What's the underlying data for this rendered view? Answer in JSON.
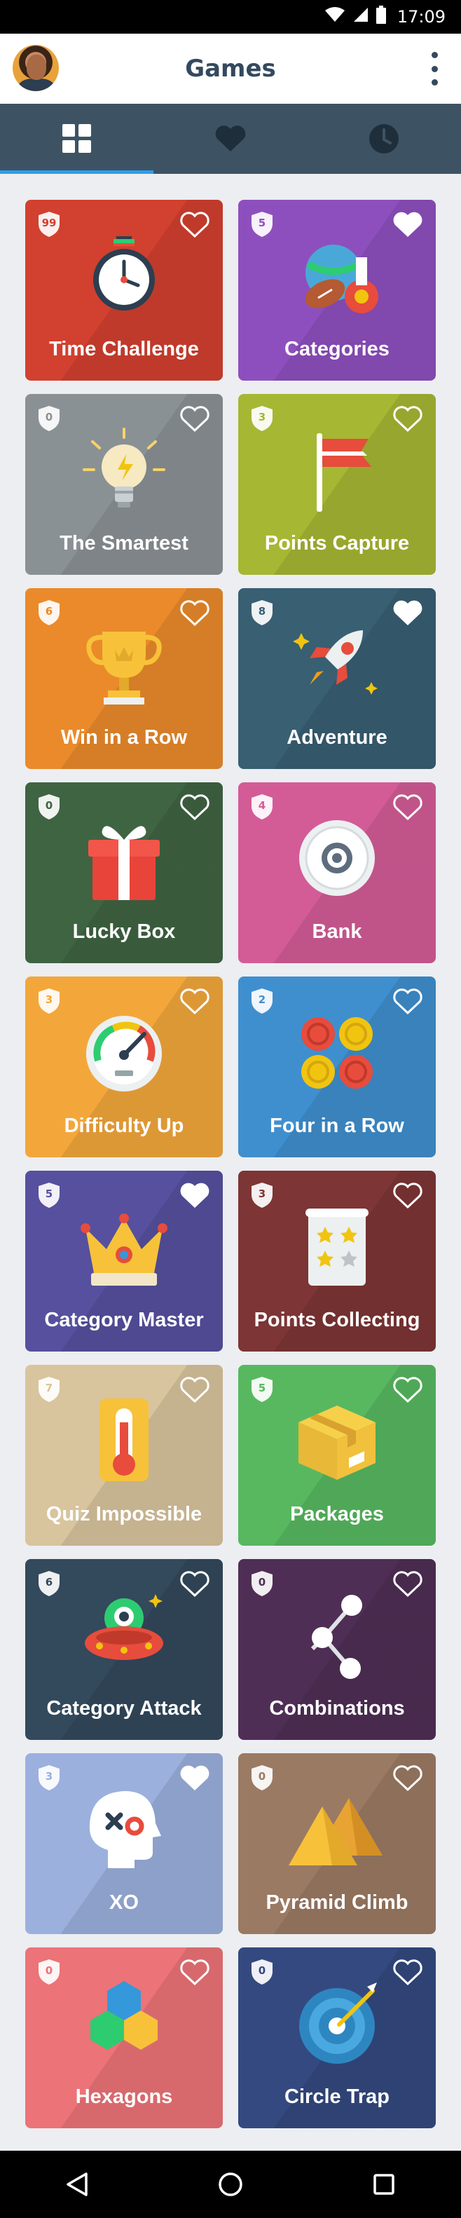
{
  "status_bar": {
    "time": "17:09"
  },
  "header": {
    "title": "Games"
  },
  "tabs": [
    {
      "icon": "grid-icon",
      "active": true
    },
    {
      "icon": "heart-icon",
      "active": false
    },
    {
      "icon": "clock-icon",
      "active": false
    }
  ],
  "games": [
    {
      "label": "Time Challenge",
      "count": "99",
      "color": "#d2402f",
      "favorite": false,
      "icon": "stopwatch-icon"
    },
    {
      "label": "Categories",
      "count": "5",
      "color": "#8e4fbe",
      "favorite": true,
      "icon": "sports-balls-icon"
    },
    {
      "label": "The Smartest",
      "count": "0",
      "color": "#8a9195",
      "favorite": false,
      "icon": "lightbulb-icon"
    },
    {
      "label": "Points Capture",
      "count": "3",
      "color": "#a6b733",
      "favorite": false,
      "icon": "flag-icon"
    },
    {
      "label": "Win in a Row",
      "count": "6",
      "color": "#ea8a2b",
      "favorite": false,
      "icon": "trophy-icon"
    },
    {
      "label": "Adventure",
      "count": "8",
      "color": "#385f72",
      "favorite": true,
      "icon": "rocket-icon"
    },
    {
      "label": "Lucky Box",
      "count": "0",
      "color": "#3f6442",
      "favorite": false,
      "icon": "gift-icon"
    },
    {
      "label": "Bank",
      "count": "4",
      "color": "#d35c97",
      "favorite": false,
      "icon": "safe-icon"
    },
    {
      "label": "Difficulty Up",
      "count": "3",
      "color": "#f3a73b",
      "favorite": false,
      "icon": "gauge-icon"
    },
    {
      "label": "Four in a Row",
      "count": "2",
      "color": "#3f8fcf",
      "favorite": false,
      "icon": "checkers-icon"
    },
    {
      "label": "Category Master",
      "count": "5",
      "color": "#56509e",
      "favorite": true,
      "icon": "crown-icon"
    },
    {
      "label": "Points Collecting",
      "count": "3",
      "color": "#7d3535",
      "favorite": false,
      "icon": "scroll-stars-icon"
    },
    {
      "label": "Quiz Impossible",
      "count": "7",
      "color": "#d8c49d",
      "favorite": false,
      "icon": "thermometer-icon"
    },
    {
      "label": "Packages",
      "count": "5",
      "color": "#57b860",
      "favorite": false,
      "icon": "package-icon"
    },
    {
      "label": "Category Attack",
      "count": "6",
      "color": "#33495c",
      "favorite": false,
      "icon": "ufo-icon"
    },
    {
      "label": "Combinations",
      "count": "0",
      "color": "#4f2e55",
      "favorite": false,
      "icon": "nodes-icon"
    },
    {
      "label": "XO",
      "count": "3",
      "color": "#9bb0dd",
      "favorite": true,
      "icon": "head-xo-icon"
    },
    {
      "label": "Pyramid Climb",
      "count": "0",
      "color": "#9b7a63",
      "favorite": false,
      "icon": "pyramid-icon"
    },
    {
      "label": "Hexagons",
      "count": "0",
      "color": "#ec7378",
      "favorite": false,
      "icon": "hexagons-icon"
    },
    {
      "label": "Circle Trap",
      "count": "0",
      "color": "#34497f",
      "favorite": false,
      "icon": "target-icon"
    }
  ],
  "nav": [
    {
      "icon": "back-icon"
    },
    {
      "icon": "home-icon"
    },
    {
      "icon": "recents-icon"
    }
  ]
}
